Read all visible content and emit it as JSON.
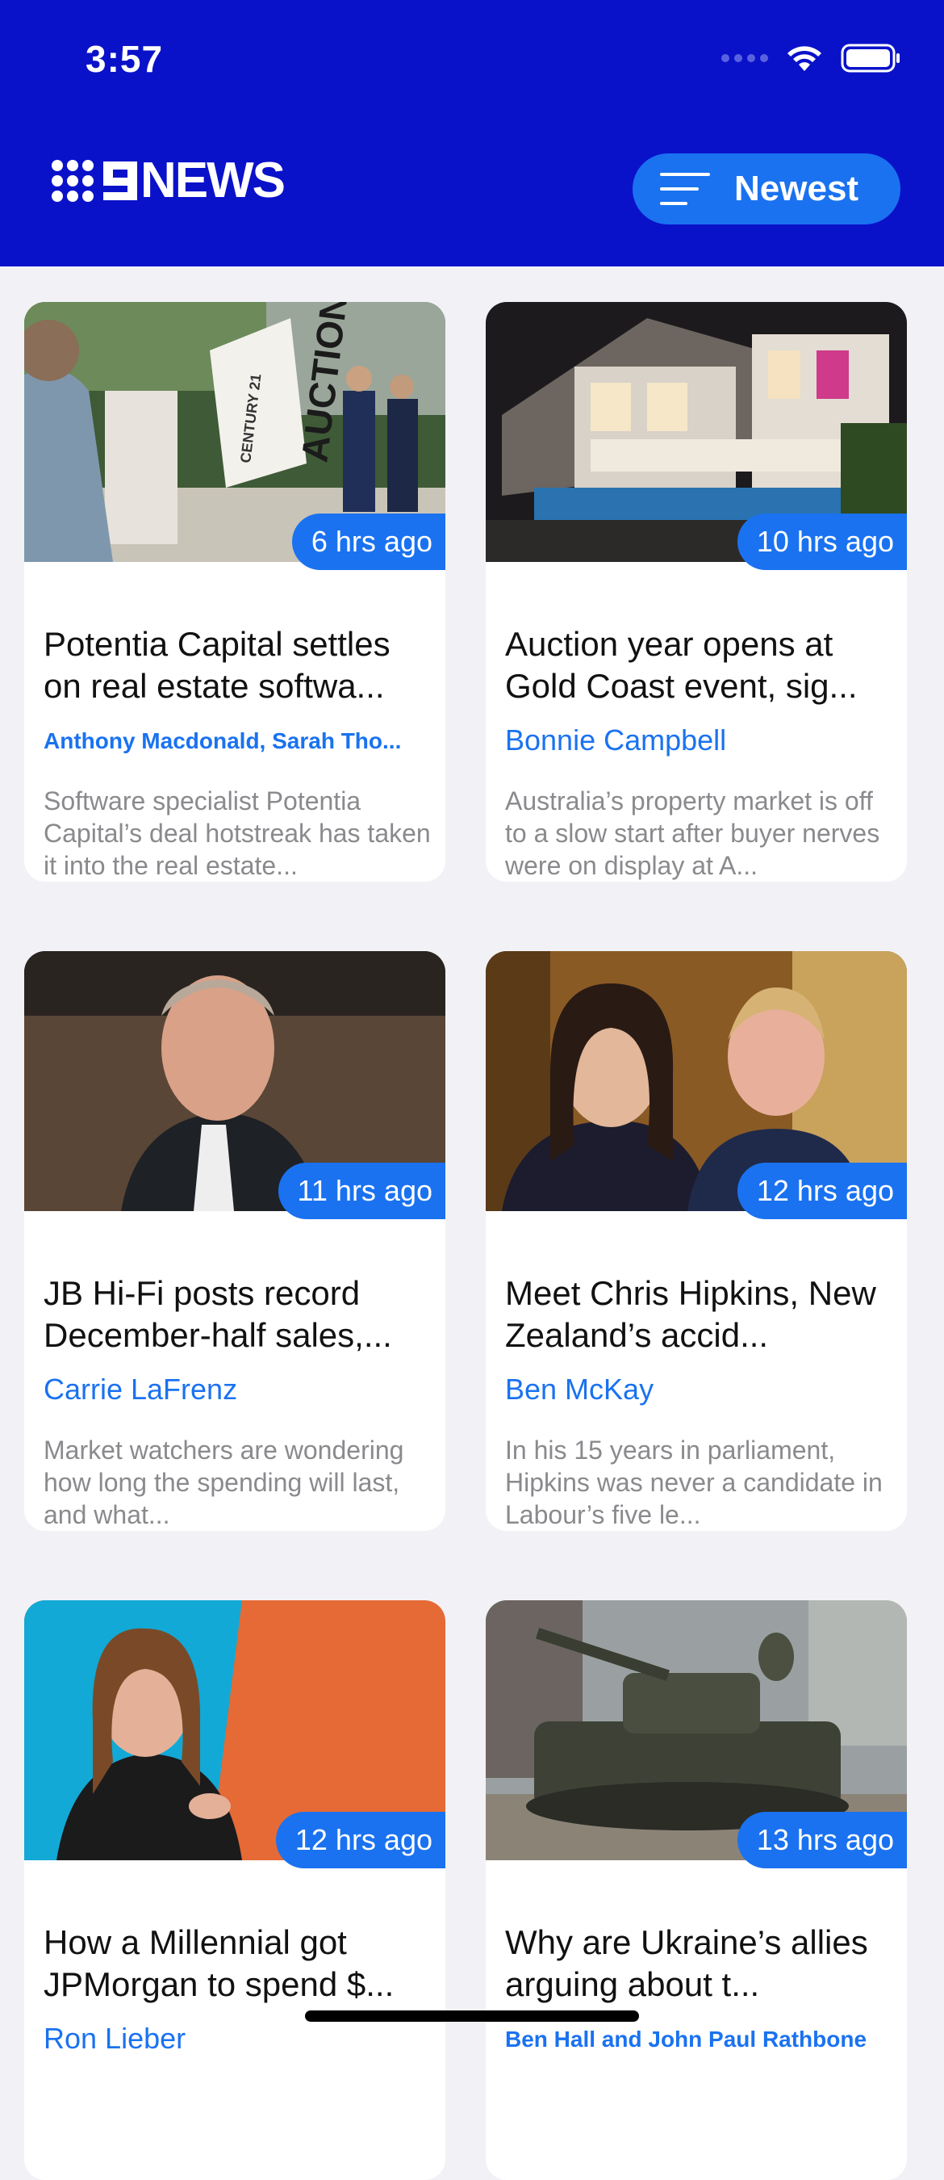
{
  "status_bar": {
    "time": "3:57"
  },
  "header": {
    "logo_text": "NEWS",
    "sort_label": "Newest"
  },
  "articles": [
    {
      "time": "6 hrs ago",
      "title": "Potentia Capital settles on real estate softwa...",
      "author": "Anthony Macdonald, Sarah Tho...",
      "summary": "Software specialist Potentia Capital’s deal hotstreak has taken it into the real estate...",
      "image_sign": "AUCTION",
      "image_sign_small": "CENTURY 21"
    },
    {
      "time": "10 hrs ago",
      "title": "Auction year opens at Gold Coast event, sig...",
      "author": "Bonnie Campbell",
      "summary": "Australia’s property market is off to a slow start after buyer nerves were on display at A..."
    },
    {
      "time": "11 hrs ago",
      "title": "JB Hi-Fi posts record December-half sales,...",
      "author": "Carrie LaFrenz",
      "summary": "Market watchers are wondering how long the spending will last, and what..."
    },
    {
      "time": "12 hrs ago",
      "title": "Meet Chris Hipkins, New Zealand’s accid...",
      "author": "Ben McKay",
      "summary": "In his 15 years in parliament, Hipkins was never a candidate in Labour’s five le..."
    },
    {
      "time": "12 hrs ago",
      "title": "How a Millennial got JPMorgan to spend $...",
      "author": "Ron Lieber",
      "summary": ""
    },
    {
      "time": "13 hrs ago",
      "title": "Why are Ukraine’s allies arguing about t...",
      "author": "Ben Hall and John Paul Rathbone",
      "summary": ""
    }
  ]
}
